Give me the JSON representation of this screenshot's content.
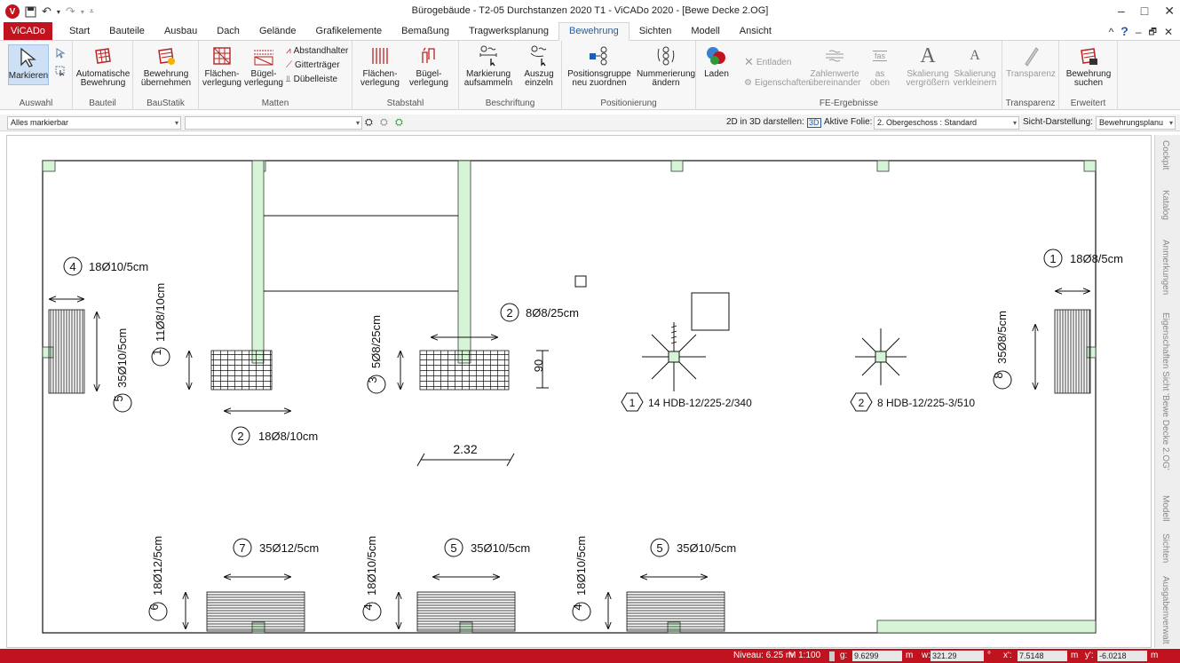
{
  "window": {
    "title": "Bürogebäude - T2-05 Durchstanzen 2020 T1 - ViCADo 2020 - [Bewe Decke 2.OG]",
    "app_icon": "vicado-logo-icon",
    "controls": [
      "–",
      "□",
      "✕"
    ]
  },
  "tabs": [
    {
      "label": "ViCADo",
      "kind": "app"
    },
    {
      "label": "Start"
    },
    {
      "label": "Bauteile"
    },
    {
      "label": "Ausbau"
    },
    {
      "label": "Dach"
    },
    {
      "label": "Gelände"
    },
    {
      "label": "Grafikelemente"
    },
    {
      "label": "Bemaßung"
    },
    {
      "label": "Tragwerksplanung"
    },
    {
      "label": "Bewehrung",
      "active": true
    },
    {
      "label": "Sichten"
    },
    {
      "label": "Modell"
    },
    {
      "label": "Ansicht"
    }
  ],
  "tabs_right": {
    "collapse": "^",
    "help": "?",
    "min": "–",
    "restore": "🗗",
    "close": "✕"
  },
  "ribbon": {
    "groups": {
      "auswahl": "Auswahl",
      "bauteil": "Bauteil",
      "baustatik": "BauStatik",
      "matten": "Matten",
      "stabstahl": "Stabstahl",
      "beschriftung": "Beschriftung",
      "positionierung": "Positionierung",
      "fe": "FE-Ergebnisse",
      "transparenz": "Transparenz",
      "erweitert": "Erweitert"
    },
    "buttons": {
      "markieren": "Markieren",
      "auto_bew_1": "Automatische",
      "auto_bew_2": "Bewehrung",
      "bew_ueb_1": "Bewehrung",
      "bew_ueb_2": "übernehmen",
      "flaechen_m_1": "Flächen-",
      "flaechen_m_2": "verlegung",
      "buegel_m_1": "Bügel-",
      "buegel_m_2": "verlegung",
      "abstandhalter": "Abstandhalter",
      "gittertraeger": "Gitterträger",
      "duebelleiste": "Dübelleiste",
      "flaechen_s_1": "Flächen-",
      "flaechen_s_2": "verlegung",
      "buegel_s_1": "Bügel-",
      "buegel_s_2": "verlegung",
      "mark_sam_1": "Markierung",
      "mark_sam_2": "aufsammeln",
      "auszug_1": "Auszug",
      "auszug_2": "einzeln",
      "posgr_1": "Positionsgruppe",
      "posgr_2": "neu zuordnen",
      "numm_1": "Nummerierung",
      "numm_2": "ändern",
      "laden": "Laden",
      "entladen": "Entladen",
      "eigenschaften": "Eigenschaften",
      "zahlen_1": "Zahlenwerte",
      "zahlen_2": "übereinander",
      "as_1": "as",
      "as_2": "oben",
      "skal_v_1": "Skalierung",
      "skal_v_2": "vergrößern",
      "skal_k_1": "Skalierung",
      "skal_k_2": "verkleinern",
      "transparenz": "Transparenz",
      "bew_such_1": "Bewehrung",
      "bew_such_2": "suchen",
      "tas": "fas"
    }
  },
  "toolbar": {
    "filter": "Alles markierbar",
    "search": "",
    "label_2d3d": "2D in 3D darstellen:",
    "label_folie": "Aktive Folie:",
    "folie_value": "2. Obergeschoss : Standard",
    "label_sicht": "Sicht-Darstellung:",
    "sicht_value": "Bewehrungsplanu"
  },
  "drawing": {
    "labels": {
      "p4_top": {
        "num": "4",
        "text": "18Ø10/5cm"
      },
      "p1_right": {
        "num": "1",
        "text": "18Ø8/5cm"
      },
      "p1_left_vert": {
        "num": "1",
        "text": "11Ø8/10cm"
      },
      "p5_left_vert": {
        "num": "5",
        "text": "35Ø10/5cm"
      },
      "p2_bottom": {
        "num": "2",
        "text": "18Ø8/10cm"
      },
      "p3_vert": {
        "num": "3",
        "text": "5Ø8/25cm"
      },
      "p2_top": {
        "num": "2",
        "text": "8Ø8/25cm"
      },
      "p8_vert": {
        "num": "8",
        "text": "35Ø8/5cm"
      },
      "hdb1": {
        "num": "1",
        "text": "14 HDB-12/225-2/340"
      },
      "hdb2": {
        "num": "2",
        "text": "8 HDB-12/225-3/510"
      },
      "p6_vert": {
        "num": "6",
        "text": "18Ø12/5cm"
      },
      "p7": {
        "num": "7",
        "text": "35Ø12/5cm"
      },
      "p4_vert_a": {
        "num": "4",
        "text": "18Ø10/5cm"
      },
      "p5_a": {
        "num": "5",
        "text": "35Ø10/5cm"
      },
      "p4_vert_b": {
        "num": "4",
        "text": "18Ø10/5cm"
      },
      "p5_b": {
        "num": "5",
        "text": "35Ø10/5cm"
      }
    },
    "dim_90": "90",
    "dim_232": "2.32"
  },
  "sidepanel": [
    "Cockpit",
    "Katalog",
    "Anmerkungen",
    "Eigenschaften Sicht 'Bewe Decke 2.OG'",
    "Modell",
    "Sichten",
    "Ausgabenverwalt"
  ],
  "status": {
    "niveau": "Niveau: 6.25 m",
    "massstab": "M 1:100",
    "g_label": "g:",
    "g_value": "9.6299",
    "g_unit": "m",
    "w_label": "w:",
    "w_value": "321.29",
    "w_unit": "°",
    "x_label": "x':",
    "x_value": "7.5148",
    "x_unit": "m",
    "y_label": "y':",
    "y_value": "-6.0218",
    "y_unit": "m"
  },
  "colors": {
    "brand": "#c1121f",
    "column_fill": "#d6f5d6",
    "accent": "#1f5fa8"
  }
}
